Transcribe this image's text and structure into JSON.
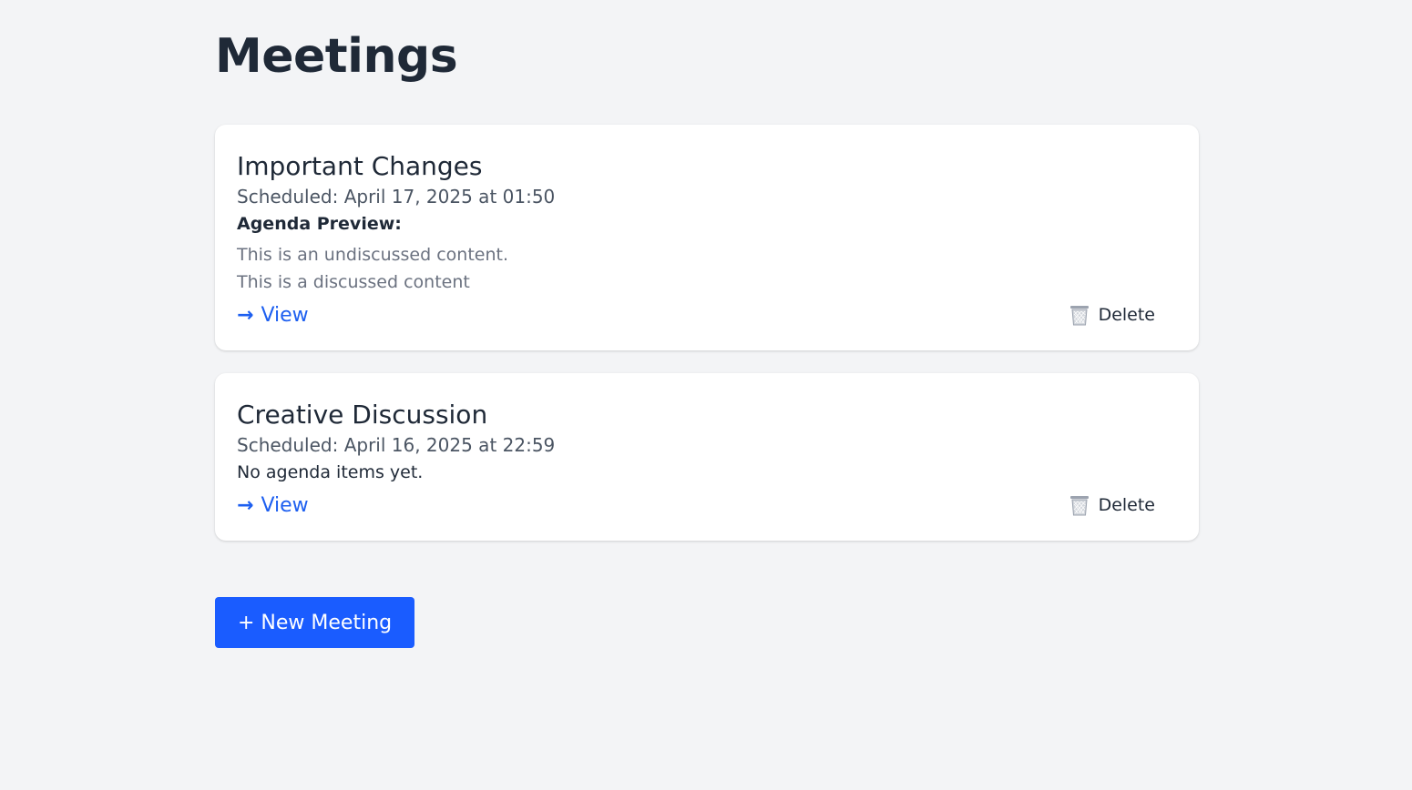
{
  "page": {
    "title": "Meetings"
  },
  "meetings": [
    {
      "title": "Important Changes",
      "scheduled": "Scheduled: April 17, 2025 at 01:50",
      "agenda_heading": "Agenda Preview:",
      "agenda_items": [
        "This is an undiscussed content.",
        "This is a discussed content"
      ],
      "view_label": "View",
      "delete_label": "Delete"
    },
    {
      "title": "Creative Discussion",
      "scheduled": "Scheduled: April 16, 2025 at 22:59",
      "no_agenda_text": "No agenda items yet.",
      "view_label": "View",
      "delete_label": "Delete"
    }
  ],
  "actions": {
    "new_meeting_label": "+ New Meeting"
  },
  "icons": {
    "view": "arrow-right-icon",
    "delete": "trash-icon"
  },
  "colors": {
    "accent": "#1a5cff",
    "link": "#1d5ff0",
    "background": "#f3f4f6"
  }
}
